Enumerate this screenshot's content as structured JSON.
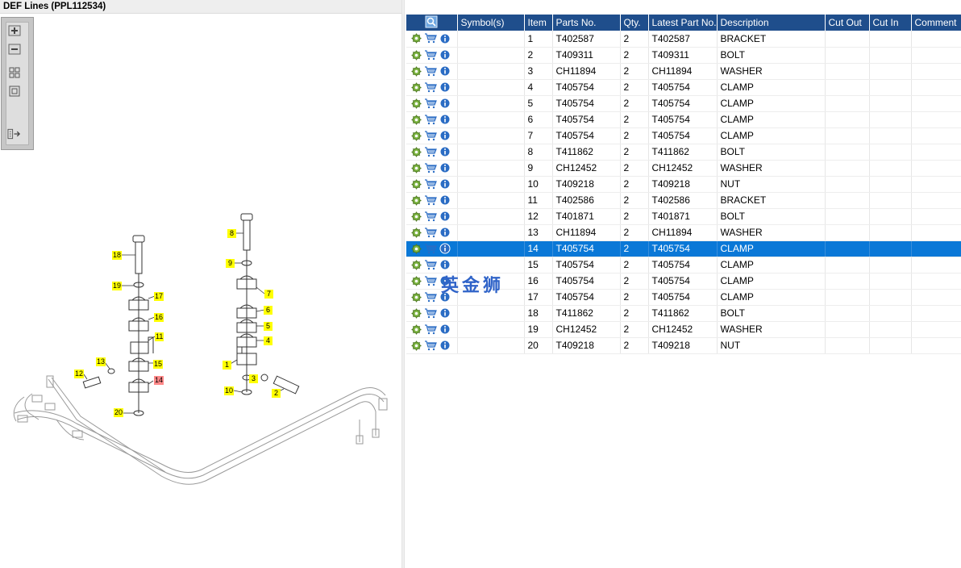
{
  "window": {
    "title": "DEF Lines (PPL112534)"
  },
  "toolbar": {
    "buttons": [
      {
        "name": "zoom-in-button",
        "icon": "zoom-in-icon"
      },
      {
        "name": "zoom-out-button",
        "icon": "zoom-out-icon"
      },
      {
        "name": "fit-all-button",
        "icon": "fit-all-icon"
      },
      {
        "name": "fit-window-button",
        "icon": "fit-window-icon"
      },
      {
        "name": "export-button",
        "icon": "export-icon"
      }
    ]
  },
  "diagram": {
    "selected_callout": "14",
    "callouts": [
      "1",
      "2",
      "3",
      "4",
      "5",
      "6",
      "7",
      "8",
      "9",
      "10",
      "11",
      "12",
      "13",
      "14",
      "15",
      "16",
      "17",
      "18",
      "19",
      "20"
    ]
  },
  "grid": {
    "columns": [
      "",
      "Symbol(s)",
      "Item",
      "Parts No.",
      "Qty.",
      "Latest Part No.",
      "Description",
      "Cut Out",
      "Cut In",
      "Comment"
    ],
    "header_icon": "search-icon",
    "row_icons": [
      "gear-icon",
      "cart-icon",
      "info-icon"
    ],
    "selected_item": "14",
    "rows": [
      {
        "item": "1",
        "part": "T402587",
        "qty": "2",
        "latest": "T402587",
        "desc": "BRACKET"
      },
      {
        "item": "2",
        "part": "T409311",
        "qty": "2",
        "latest": "T409311",
        "desc": "BOLT"
      },
      {
        "item": "3",
        "part": "CH11894",
        "qty": "2",
        "latest": "CH11894",
        "desc": "WASHER"
      },
      {
        "item": "4",
        "part": "T405754",
        "qty": "2",
        "latest": "T405754",
        "desc": "CLAMP"
      },
      {
        "item": "5",
        "part": "T405754",
        "qty": "2",
        "latest": "T405754",
        "desc": "CLAMP"
      },
      {
        "item": "6",
        "part": "T405754",
        "qty": "2",
        "latest": "T405754",
        "desc": "CLAMP"
      },
      {
        "item": "7",
        "part": "T405754",
        "qty": "2",
        "latest": "T405754",
        "desc": "CLAMP"
      },
      {
        "item": "8",
        "part": "T411862",
        "qty": "2",
        "latest": "T411862",
        "desc": "BOLT"
      },
      {
        "item": "9",
        "part": "CH12452",
        "qty": "2",
        "latest": "CH12452",
        "desc": "WASHER"
      },
      {
        "item": "10",
        "part": "T409218",
        "qty": "2",
        "latest": "T409218",
        "desc": "NUT"
      },
      {
        "item": "11",
        "part": "T402586",
        "qty": "2",
        "latest": "T402586",
        "desc": "BRACKET"
      },
      {
        "item": "12",
        "part": "T401871",
        "qty": "2",
        "latest": "T401871",
        "desc": "BOLT"
      },
      {
        "item": "13",
        "part": "CH11894",
        "qty": "2",
        "latest": "CH11894",
        "desc": "WASHER"
      },
      {
        "item": "14",
        "part": "T405754",
        "qty": "2",
        "latest": "T405754",
        "desc": "CLAMP"
      },
      {
        "item": "15",
        "part": "T405754",
        "qty": "2",
        "latest": "T405754",
        "desc": "CLAMP"
      },
      {
        "item": "16",
        "part": "T405754",
        "qty": "2",
        "latest": "T405754",
        "desc": "CLAMP"
      },
      {
        "item": "17",
        "part": "T405754",
        "qty": "2",
        "latest": "T405754",
        "desc": "CLAMP"
      },
      {
        "item": "18",
        "part": "T411862",
        "qty": "2",
        "latest": "T411862",
        "desc": "BOLT"
      },
      {
        "item": "19",
        "part": "CH12452",
        "qty": "2",
        "latest": "CH12452",
        "desc": "WASHER"
      },
      {
        "item": "20",
        "part": "T409218",
        "qty": "2",
        "latest": "T409218",
        "desc": "NUT"
      }
    ]
  },
  "watermark": {
    "text": "英金狮"
  },
  "colors": {
    "header_bg": "#1f4e8c",
    "selected_row_bg": "#0a78d7",
    "callout_bg": "#ffff00",
    "callout_selected_bg": "#ff8888",
    "gear_icon": "#7cb342",
    "cart_icon": "#2a6cc4",
    "info_icon": "#2a6cc4"
  }
}
